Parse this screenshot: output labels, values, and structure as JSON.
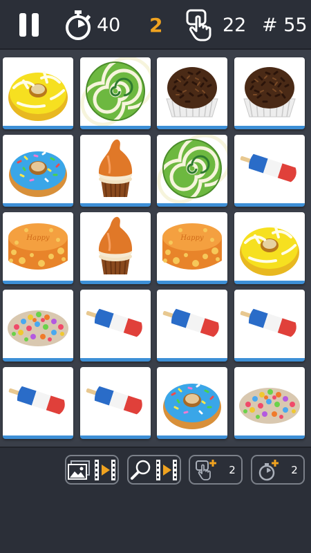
{
  "topbar": {
    "pause_icon": "pause-icon",
    "timer_icon": "stopwatch-icon",
    "time_remaining": "40",
    "pairs_found": "2",
    "moves_icon": "tap-hand-icon",
    "moves": "22",
    "level": "# 55"
  },
  "colors": {
    "background": "#3a3f49",
    "bar": "#2b2f38",
    "accent_orange": "#f0a320",
    "card_edge": "#3d8fd6",
    "button_border": "#7b8089"
  },
  "board": {
    "rows": 5,
    "columns": 4,
    "cards": [
      [
        "yellow-donut",
        "green-swirl-lollipop",
        "chocolate-truffle",
        "chocolate-truffle"
      ],
      [
        "blue-donut",
        "caramel-cupcake",
        "green-swirl-lollipop",
        "popsicle"
      ],
      [
        "orange-birthday-cake",
        "caramel-cupcake",
        "orange-birthday-cake",
        "yellow-donut"
      ],
      [
        "candy-pile",
        "popsicle",
        "popsicle",
        "popsicle"
      ],
      [
        "popsicle",
        "popsicle",
        "blue-donut",
        "candy-pile"
      ]
    ]
  },
  "bottombar": {
    "reveal_video_button": {
      "icons": [
        "picture-icon",
        "video-play-icon"
      ]
    },
    "hint_video_button": {
      "icons": [
        "magnifier-icon",
        "video-play-icon"
      ]
    },
    "extra_moves_button": {
      "icon": "tap-hand-plus-icon",
      "count": "2"
    },
    "extra_time_button": {
      "icon": "stopwatch-plus-icon",
      "count": "2"
    }
  }
}
